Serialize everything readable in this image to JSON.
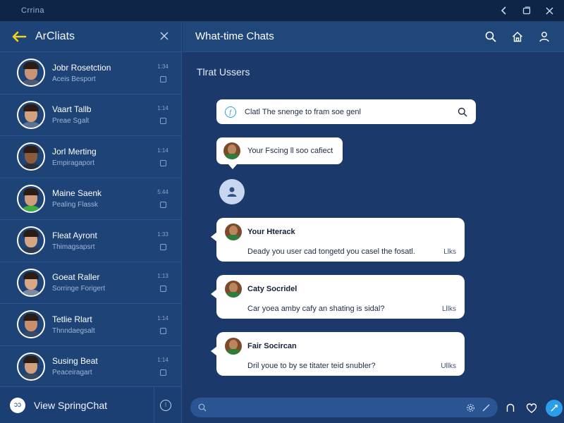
{
  "window": {
    "title": "Crrina"
  },
  "sidebar": {
    "title": "ArCliats",
    "contacts": [
      {
        "name": "Jobr Rosetction",
        "sub": "Aceis Besport",
        "time": "1:34",
        "shirt": "#4a5a78",
        "skin": "#c89474"
      },
      {
        "name": "Vaart Tallb",
        "sub": "Preae Sgalt",
        "time": "1:14",
        "shirt": "#5c6f94",
        "skin": "#d3a17d"
      },
      {
        "name": "Jorl Merting",
        "sub": "Empiragaport",
        "time": "1:14",
        "shirt": "#2a2f3a",
        "skin": "#8a5b3c"
      },
      {
        "name": "Maine Saenk",
        "sub": "Pealing Flassk",
        "time": "5:44",
        "shirt": "#3fae3f",
        "skin": "#cf9e7b"
      },
      {
        "name": "Fleat Ayront",
        "sub": "Thimagsapsrt",
        "time": "1:33",
        "shirt": "#2e3950",
        "skin": "#d6a684"
      },
      {
        "name": "Goeat Raller",
        "sub": "Sorringe Forigert",
        "time": "1:13",
        "shirt": "#7d8aa3",
        "skin": "#d8a887"
      },
      {
        "name": "Tetlie Rlart",
        "sub": "Thnndaegsalt",
        "time": "1:14",
        "shirt": "#3a4a66",
        "skin": "#c98f6c"
      },
      {
        "name": "Susing Beat",
        "sub": "Peaceiragart",
        "time": "1:14",
        "shirt": "#394863",
        "skin": "#d2a07e"
      }
    ],
    "footer_label": "View SpringChat",
    "footer_icon_text": "ↄↄ",
    "footer_end_text": "⁝"
  },
  "main": {
    "title": "What-time Chats",
    "section_title": "Tlrat Ussers",
    "search": {
      "badge": "ƒ",
      "text": "Clatl The snenge to fram soe genl"
    },
    "bubble": {
      "text": "Your Fscing ll soo cafiect"
    },
    "cards": [
      {
        "name": "Your Hterack",
        "message": "Deady you user cad tongetd you casel the fosatl.",
        "like": "Llks"
      },
      {
        "name": "Caty Socridel",
        "message": "Car yoea amby cafy an shating is sidal?",
        "like": "Lllks"
      },
      {
        "name": "Fair Socircan",
        "message": "Dril youe to by se titater teid snubler?",
        "like": "Ullks"
      }
    ],
    "composer": {
      "placeholder": ""
    }
  },
  "colors": {
    "accent": "#2b9ee8",
    "back_arrow": "#f2d21b",
    "sidebar_bg": "#1d4377",
    "main_bg": "#1b3a6b"
  },
  "icons": {
    "titlebar": [
      "chevron-left-icon",
      "restore-icon",
      "close-icon"
    ],
    "header": [
      "search-icon",
      "home-icon",
      "user-icon"
    ],
    "composer": [
      "search-icon",
      "gear-icon",
      "pen-icon"
    ],
    "bottom": [
      "bell-icon",
      "heart-icon",
      "pen-icon"
    ]
  }
}
